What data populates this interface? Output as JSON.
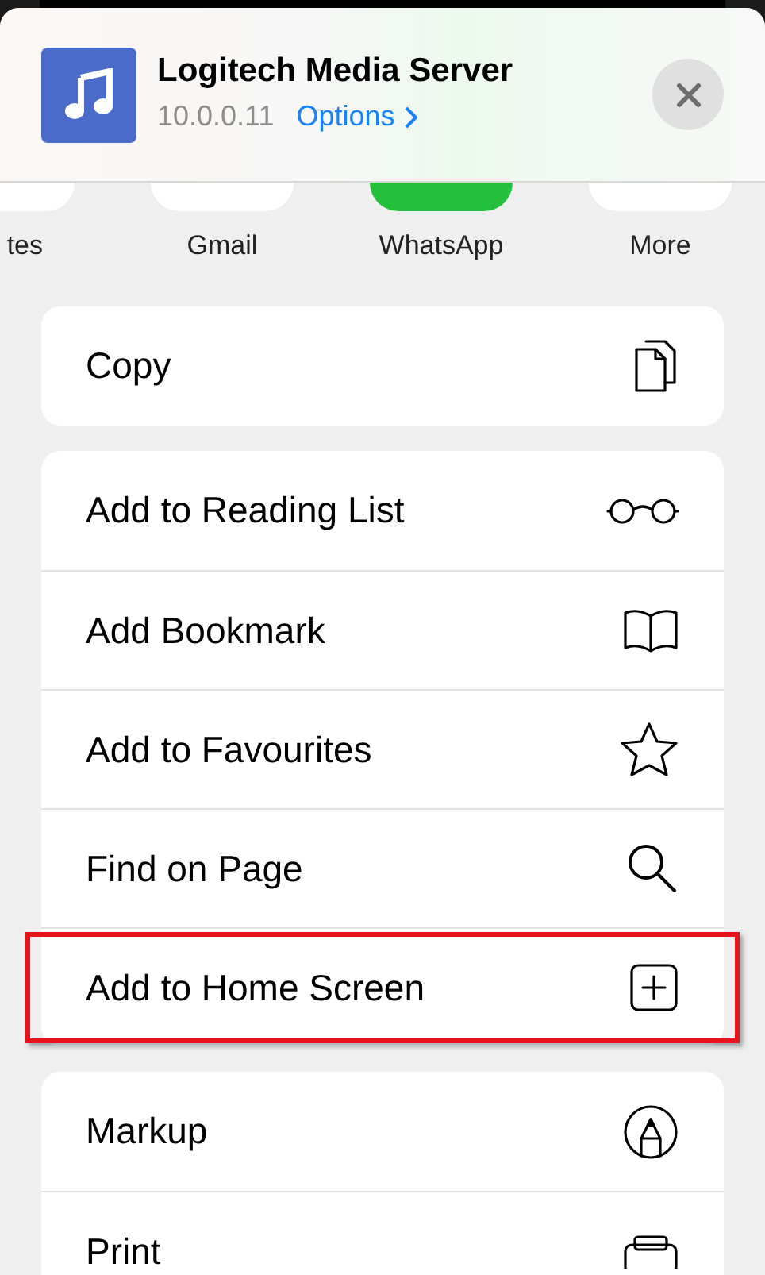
{
  "header": {
    "title": "Logitech Media Server",
    "subtitle": "10.0.0.11",
    "options_link": "Options"
  },
  "apps": [
    {
      "label": "tes",
      "kind": "plain"
    },
    {
      "label": "Gmail",
      "kind": "plain"
    },
    {
      "label": "WhatsApp",
      "kind": "whatsapp"
    },
    {
      "label": "More",
      "kind": "plain"
    }
  ],
  "groups": [
    [
      {
        "label": "Copy",
        "kind": "copy",
        "highlighted": false
      }
    ],
    [
      {
        "label": "Add to Reading List",
        "kind": "glasses",
        "highlighted": false
      },
      {
        "label": "Add Bookmark",
        "kind": "book",
        "highlighted": false
      },
      {
        "label": "Add to Favourites",
        "kind": "star",
        "highlighted": false
      },
      {
        "label": "Find on Page",
        "kind": "search",
        "highlighted": false
      },
      {
        "label": "Add to Home Screen",
        "kind": "plus",
        "highlighted": true
      }
    ],
    [
      {
        "label": "Markup",
        "kind": "markup",
        "highlighted": false
      },
      {
        "label": "Print",
        "kind": "print",
        "highlighted": false
      }
    ]
  ]
}
